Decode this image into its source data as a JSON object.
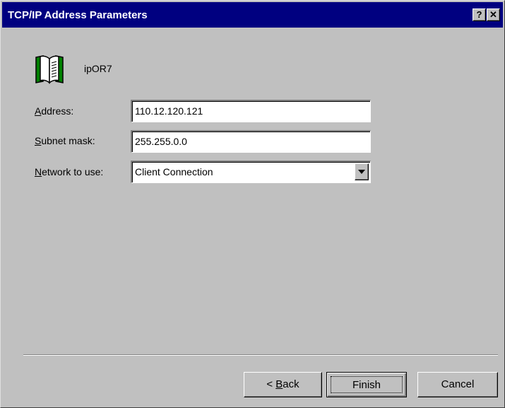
{
  "window": {
    "title": "TCP/IP Address Parameters",
    "help_label": "?",
    "close_label": "✕"
  },
  "header": {
    "host_name": "ipOR7",
    "icon": "book-icon"
  },
  "form": {
    "address": {
      "label_accel": "A",
      "label_rest": "ddress:",
      "value": "110.12.120.121"
    },
    "subnet": {
      "label_accel": "S",
      "label_rest": "ubnet mask:",
      "value": "255.255.0.0"
    },
    "network": {
      "label_accel": "N",
      "label_rest": "etwork to use:",
      "value": "Client Connection"
    }
  },
  "buttons": {
    "back_prefix": "< ",
    "back_accel": "B",
    "back_rest": "ack",
    "finish": "Finish",
    "cancel": "Cancel"
  },
  "colors": {
    "titlebar": "#000080",
    "face": "#c0c0c0",
    "icon_green": "#008000"
  }
}
